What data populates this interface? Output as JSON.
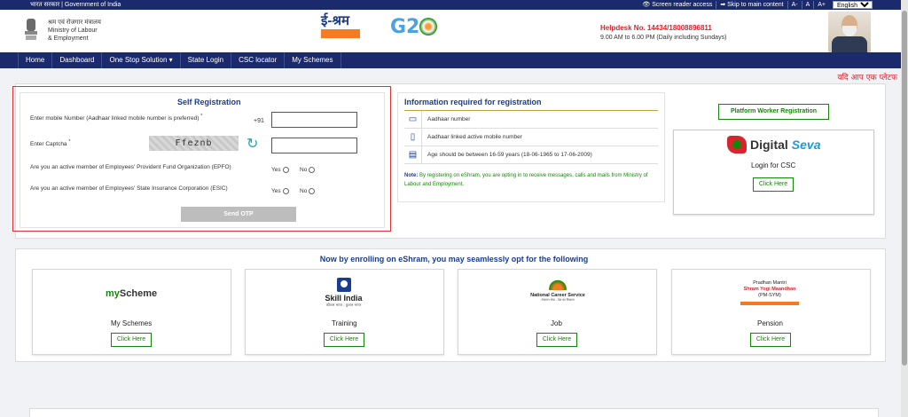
{
  "topbar": {
    "gov": "भारत सरकार | Government of India",
    "links": [
      "👁 Screen reader access",
      "➡ Skip to main content",
      "A-",
      "A",
      "A+"
    ],
    "language": "English"
  },
  "header": {
    "ministry_hi": "श्रम एवं रोजगार मंत्रालय",
    "ministry_en1": "Ministry of Labour",
    "ministry_en2": "& Employment",
    "eshram_logo": "ई-श्रम",
    "g20_logo": "G2",
    "helpdesk": "Helpdesk No. 14434/18008896811",
    "hours": "9.00 AM to 6.00 PM (Daily including Sundays)"
  },
  "nav": [
    "Home",
    "Dashboard",
    "One Stop Solution ▾",
    "State Login",
    "CSC locator",
    "My Schemes"
  ],
  "marquee": "यदि आप एक प्लेटफ",
  "registration": {
    "title": "Self Registration",
    "mobile_label": "Enter mobile Number (Aadhaar linked mobile number is preferred)",
    "mobile_prefix": "+91",
    "captcha_label": "Enter Captcha",
    "captcha_text": "Ffeznb",
    "epfo_label": "Are you an active member of Employees' Provident Fund Organization (EPFO)",
    "esic_label": "Are you an active member of Employees' State Insurance Corporation (ESIC)",
    "yes": "Yes",
    "no": "No",
    "send_otp": "Send OTP"
  },
  "info": {
    "title": "Information required for registration",
    "rows": [
      "Aadhaar number",
      "Aadhaar linked active mobile number",
      "Age should be between 16-59 years (18-06-1965 to 17-06-2009)"
    ],
    "note_label": "Note:",
    "note_text": "By registering on eShram, you are opting in to receive messages, calls and mails from Ministry of Labour and Employment."
  },
  "side": {
    "platform_btn": "Platform Worker Registration",
    "digital": "Digital",
    "seva": "Seva",
    "login_csc": "Login for CSC",
    "click_here": "Click Here"
  },
  "enroll": {
    "title": "Now by enrolling on eShram, you may seamlessly opt for the following",
    "cards": [
      {
        "title": "My Schemes",
        "button": "Click Here"
      },
      {
        "title": "Training",
        "button": "Click Here"
      },
      {
        "title": "Job",
        "button": "Click Here"
      },
      {
        "title": "Pension",
        "button": "Click Here"
      }
    ],
    "myscheme_my": "my",
    "myscheme_rest": "Scheme",
    "skill_title": "Skill India",
    "skill_sub": "कौशल भारत - कुशल भारत",
    "ncs_title": "National Career Service",
    "ncs_sub": "रोजगार सेवा - देश का विकास",
    "pm_1": "Pradhan Mantri",
    "pm_2": "Shram Yogi Maandhan",
    "pm_3": "(PM-SYM)"
  }
}
